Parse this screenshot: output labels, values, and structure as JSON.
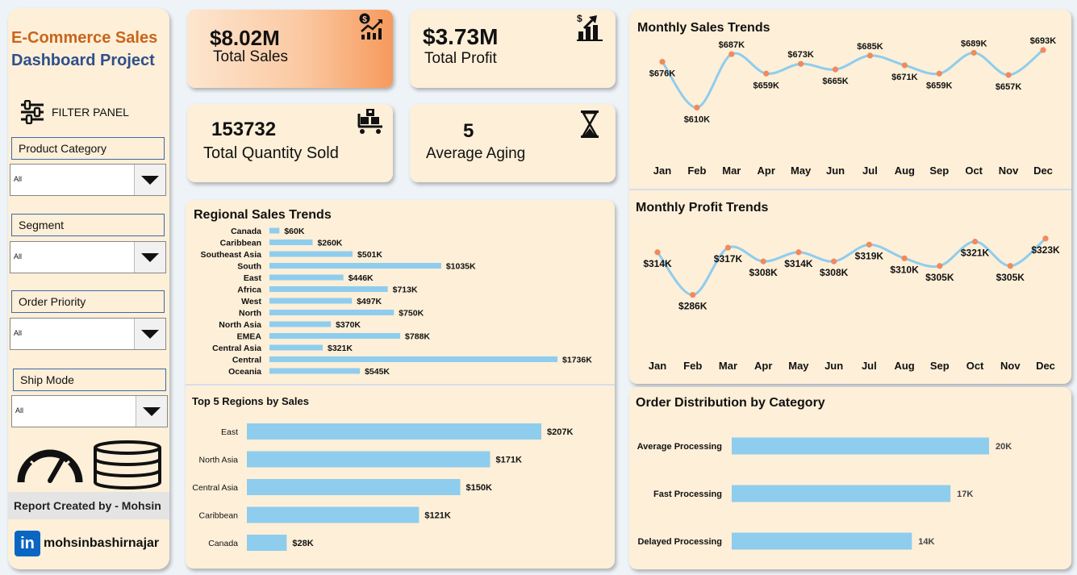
{
  "sidebar": {
    "title_line1": "E-Commerce Sales",
    "title_line2": "Dashboard Project",
    "filter_panel_label": "FILTER PANEL",
    "filters": [
      {
        "label": "Product Category",
        "value": "All"
      },
      {
        "label": "Segment",
        "value": "All"
      },
      {
        "label": "Order Priority",
        "value": "All"
      },
      {
        "label": "Ship Mode",
        "value": "All"
      }
    ],
    "report_credit": "Report Created by - Mohsin",
    "linkedin_icon_text": "in",
    "linkedin_handle": "mohsinbashirnajar"
  },
  "kpis": {
    "total_sales": {
      "value": "$8.02M",
      "label": "Total Sales"
    },
    "total_profit": {
      "value": "$3.73M",
      "label": "Total Profit"
    },
    "total_quantity": {
      "value": "153732",
      "label": "Total Quantity Sold"
    },
    "average_aging": {
      "value": "5",
      "label": "Average Aging"
    }
  },
  "colors": {
    "panel": "#fdefd8",
    "bar": "#8ecdee",
    "line": "#8ecdee",
    "marker": "#f08a5d",
    "sales_card_from": "#fde6cf",
    "sales_card_to": "#f69a5c"
  },
  "chart_data": [
    {
      "id": "monthly_sales",
      "type": "line",
      "title": "Monthly Sales Trends",
      "categories": [
        "Jan",
        "Feb",
        "Mar",
        "Apr",
        "May",
        "Jun",
        "Jul",
        "Aug",
        "Sep",
        "Oct",
        "Nov",
        "Dec"
      ],
      "values": [
        676,
        610,
        687,
        659,
        673,
        665,
        685,
        671,
        659,
        689,
        657,
        693
      ],
      "labels": [
        "$676K",
        "$610K",
        "$687K",
        "$659K",
        "$673K",
        "$665K",
        "$685K",
        "$671K",
        "$659K",
        "$689K",
        "$657K",
        "$693K"
      ],
      "ylim": [
        600,
        700
      ]
    },
    {
      "id": "monthly_profit",
      "type": "line",
      "title": "Monthly Profit Trends",
      "categories": [
        "Jan",
        "Feb",
        "Mar",
        "Apr",
        "May",
        "Jun",
        "Jul",
        "Aug",
        "Sep",
        "Oct",
        "Nov",
        "Dec"
      ],
      "values": [
        314,
        286,
        317,
        308,
        314,
        308,
        319,
        310,
        305,
        321,
        305,
        323
      ],
      "labels": [
        "$314K",
        "$286K",
        "$317K",
        "$308K",
        "$314K",
        "$308K",
        "$319K",
        "$310K",
        "$305K",
        "$321K",
        "$305K",
        "$323K"
      ],
      "ylim": [
        280,
        325
      ]
    },
    {
      "id": "regional_sales",
      "type": "bar",
      "title": "Regional Sales Trends",
      "categories": [
        "Canada",
        "Caribbean",
        "Southeast Asia",
        "South",
        "East",
        "Africa",
        "West",
        "North",
        "North Asia",
        "EMEA",
        "Central Asia",
        "Central",
        "Oceania"
      ],
      "values": [
        60,
        260,
        501,
        1035,
        446,
        713,
        497,
        750,
        370,
        788,
        321,
        1736,
        545
      ],
      "labels": [
        "$60K",
        "$260K",
        "$501K",
        "$1035K",
        "$446K",
        "$713K",
        "$497K",
        "$750K",
        "$370K",
        "$788K",
        "$321K",
        "$1736K",
        "$545K"
      ],
      "xlim": [
        0,
        1736
      ]
    },
    {
      "id": "top5_regions",
      "type": "bar",
      "title": "Top 5 Regions by Sales",
      "categories": [
        "East",
        "North Asia",
        "Central Asia",
        "Caribbean",
        "Canada"
      ],
      "values": [
        207,
        171,
        150,
        121,
        28
      ],
      "labels": [
        "$207K",
        "$171K",
        "$150K",
        "$121K",
        "$28K"
      ],
      "xlim": [
        0,
        207
      ]
    },
    {
      "id": "order_distribution",
      "type": "bar",
      "title": "Order Distribution by Category",
      "categories": [
        "Average Processing",
        "Fast Processing",
        "Delayed Processing"
      ],
      "values": [
        20,
        17,
        14
      ],
      "labels": [
        "20K",
        "17K",
        "14K"
      ],
      "xlim": [
        0,
        20
      ]
    }
  ]
}
